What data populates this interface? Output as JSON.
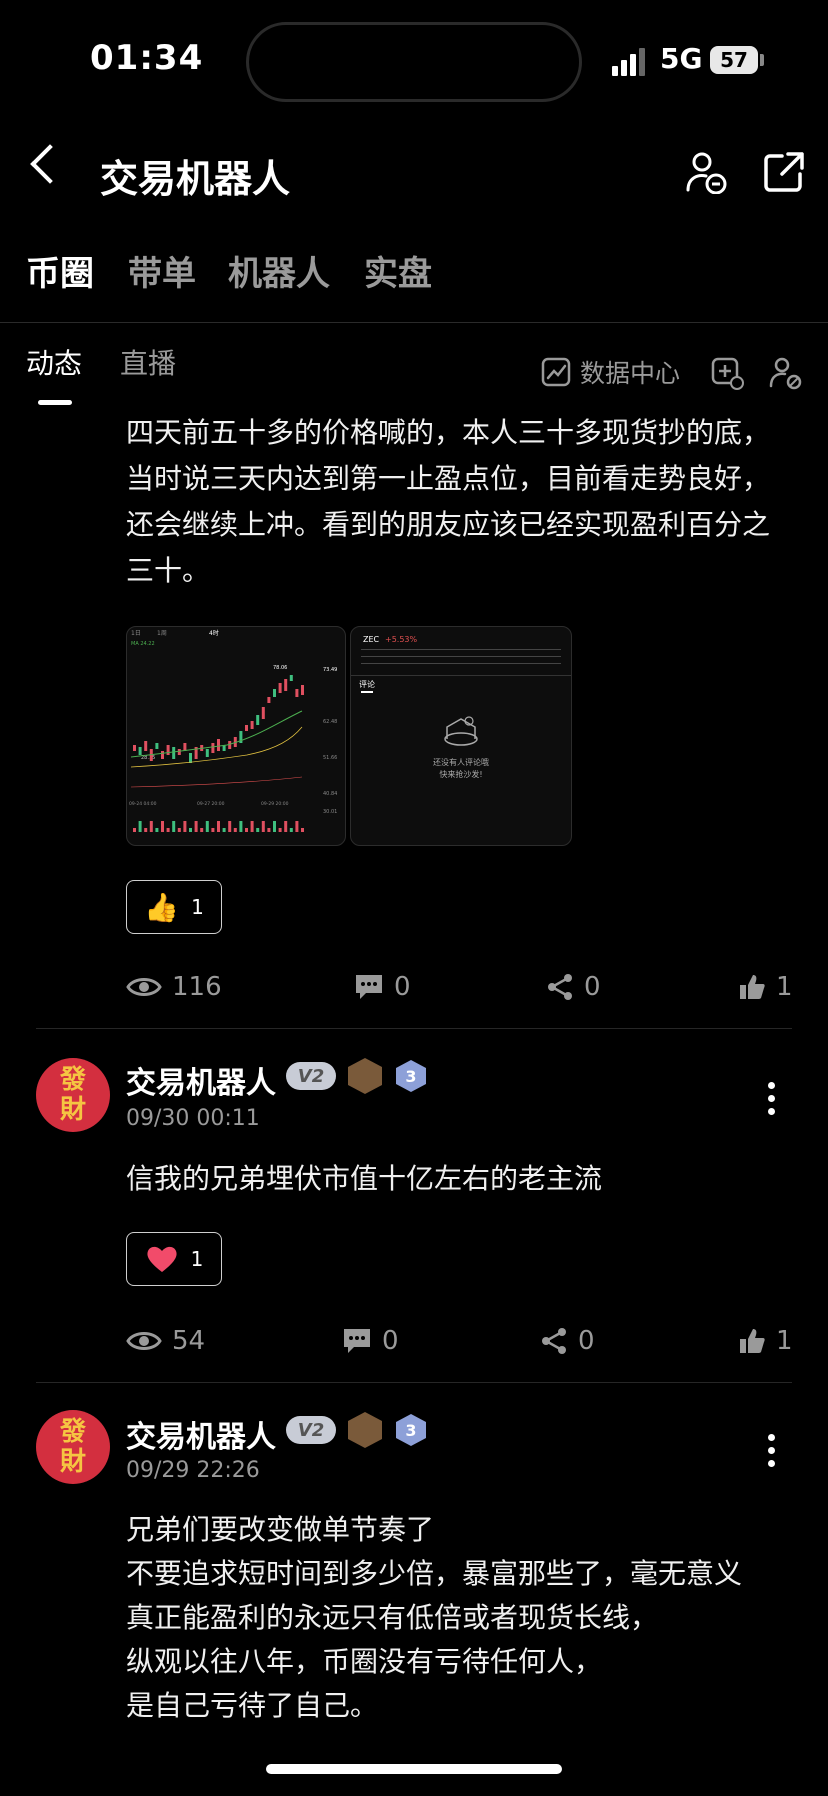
{
  "status": {
    "time": "01:34",
    "network": "5G",
    "battery": "57"
  },
  "header": {
    "title": "交易机器人"
  },
  "tabs": [
    "币圈",
    "带单",
    "机器人",
    "实盘"
  ],
  "subtabs": [
    "动态",
    "直播"
  ],
  "data_center": "数据中心",
  "post1": {
    "text": "四天前五十多的价格喊的，本人三十多现货抄的底，当时说三天内达到第一止盈点位，目前看走势良好，还会继续上冲。看到的朋友应该已经实现盈利百分之三十。",
    "reaction_count": "1",
    "views": "116",
    "comments": "0",
    "shares": "0",
    "likes": "1",
    "chart_img": {
      "tabs": [
        "1日",
        "1周",
        "4时"
      ],
      "price_labels": [
        "78.06",
        "73.49",
        "62.48",
        "51.66",
        "40.84",
        "30.01"
      ],
      "date_labels": [
        "09-24 04:00",
        "09-27 20:00",
        "09-29 20:00"
      ],
      "label_top": "MA 24.22",
      "label_low": "28.15"
    },
    "comment_img": {
      "coin": "ZEC",
      "change": "+5.53%",
      "tab": "评论",
      "empty1": "还没有人评论哦",
      "empty2": "快来抢沙发!"
    }
  },
  "post2": {
    "avatar_top": "發",
    "avatar_bottom": "財",
    "author": "交易机器人",
    "badge": "V2",
    "level": "3",
    "time": "09/30 00:11",
    "text": "信我的兄弟埋伏市值十亿左右的老主流",
    "reaction_count": "1",
    "views": "54",
    "comments": "0",
    "shares": "0",
    "likes": "1"
  },
  "post3": {
    "avatar_top": "發",
    "avatar_bottom": "財",
    "author": "交易机器人",
    "badge": "V2",
    "level": "3",
    "time": "09/29 22:26",
    "lines": [
      "兄弟们要改变做单节奏了",
      "不要追求短时间到多少倍，暴富那些了，毫无意义",
      "真正能盈利的永远只有低倍或者现货长线，",
      "纵观以往八年，币圈没有亏待任何人，",
      "是自己亏待了自己。"
    ]
  },
  "colors": {
    "bg": "#000000",
    "avatar": "#d32f3f",
    "muted": "#9a9a9a"
  }
}
